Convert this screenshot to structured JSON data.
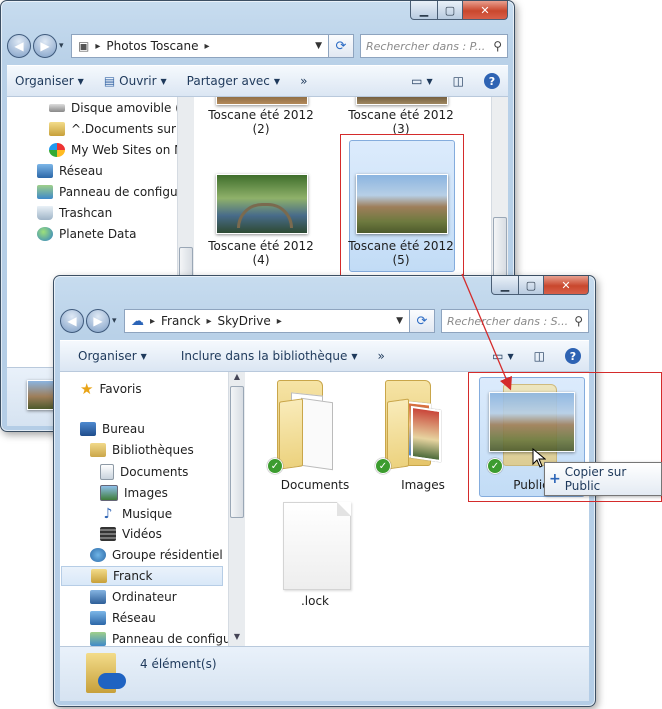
{
  "window_back": {
    "breadcrumb": [
      "Photos Toscane"
    ],
    "search_placeholder": "Rechercher dans : P...",
    "toolbar": {
      "organize": "Organiser",
      "open": "Ouvrir",
      "share": "Partager avec",
      "more": "»"
    },
    "nav_items": [
      {
        "label": "Disque amovible (L:)",
        "icon": "usb-drive-icon"
      },
      {
        "label": "^.Documents sur d.c",
        "icon": "network-folder-icon"
      },
      {
        "label": "My Web Sites on MS",
        "icon": "msn-icon"
      },
      {
        "label": "Réseau",
        "icon": "network-icon"
      },
      {
        "label": "Panneau de configura",
        "icon": "control-panel-icon"
      },
      {
        "label": "Trashcan",
        "icon": "recycle-bin-icon"
      },
      {
        "label": "Planete Data",
        "icon": "globe-icon"
      }
    ],
    "files": [
      {
        "name": "Toscane été 2012",
        "number": "(2)"
      },
      {
        "name": "Toscane été 2012",
        "number": "(3)"
      },
      {
        "name": "Toscane été 2012",
        "number": "(4)"
      },
      {
        "name": "Toscane été 2012",
        "number": "(5)"
      }
    ]
  },
  "window_front": {
    "breadcrumb": [
      "Franck",
      "SkyDrive"
    ],
    "search_placeholder": "Rechercher dans : S...",
    "toolbar": {
      "organize": "Organiser",
      "include": "Inclure dans la bibliothèque",
      "more": "»"
    },
    "nav_items": [
      {
        "label": "Favoris",
        "icon": "star-icon"
      },
      {
        "label": "Bureau",
        "icon": "desktop-icon"
      },
      {
        "label": "Bibliothèques",
        "icon": "libraries-icon"
      },
      {
        "label": "Documents",
        "icon": "documents-icon"
      },
      {
        "label": "Images",
        "icon": "pictures-icon"
      },
      {
        "label": "Musique",
        "icon": "music-icon"
      },
      {
        "label": "Vidéos",
        "icon": "videos-icon"
      },
      {
        "label": "Groupe résidentiel",
        "icon": "homegroup-icon"
      },
      {
        "label": "Franck",
        "icon": "user-folder-icon"
      },
      {
        "label": "Ordinateur",
        "icon": "computer-icon"
      },
      {
        "label": "Réseau",
        "icon": "network-icon"
      },
      {
        "label": "Panneau de configura",
        "icon": "control-panel-icon"
      }
    ],
    "files": [
      {
        "name": "Documents"
      },
      {
        "name": "Images"
      },
      {
        "name": "Public"
      },
      {
        "name": ".lock"
      }
    ],
    "status": "4 élément(s)",
    "drag_tooltip": "Copier sur Public"
  },
  "colors": {
    "selection": "#c2dcf6",
    "highlight_box": "#d42b2b",
    "sync_check": "#3c9c2f"
  }
}
